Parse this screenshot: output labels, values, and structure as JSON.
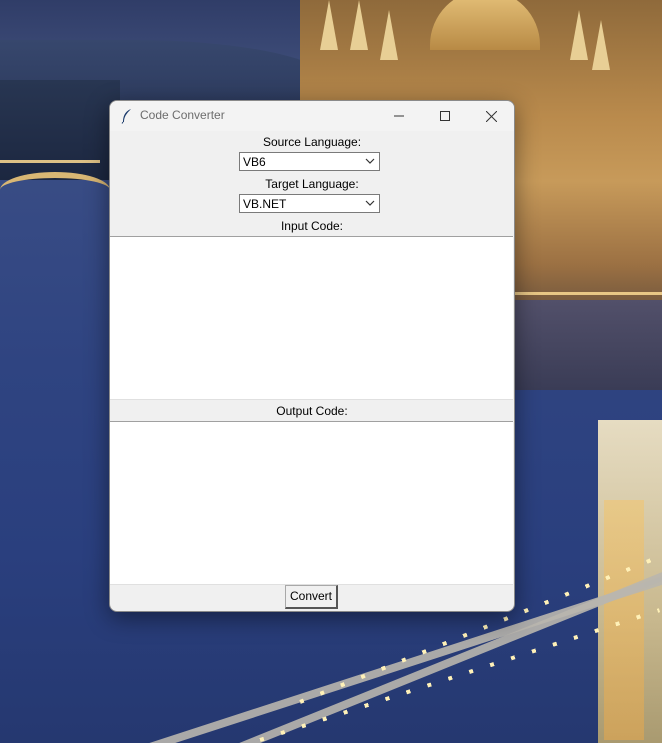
{
  "window": {
    "title": "Code Converter",
    "icon": "feather-icon",
    "controls": [
      "minimize-icon",
      "maximize-icon",
      "close-icon"
    ]
  },
  "source": {
    "label": "Source Language:",
    "value": "VB6"
  },
  "target": {
    "label": "Target Language:",
    "value": "VB.NET"
  },
  "input": {
    "label": "Input Code:",
    "value": ""
  },
  "output": {
    "label": "Output Code:",
    "value": ""
  },
  "convert_label": "Convert"
}
